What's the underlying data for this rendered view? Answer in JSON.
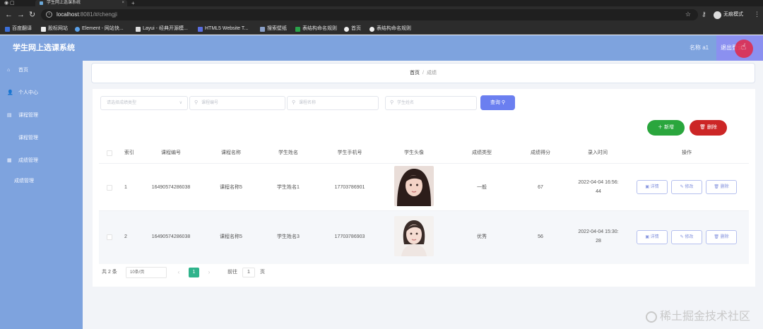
{
  "browser": {
    "tab_title": "学生网上选课系统",
    "url_host": "localhost",
    "url_rest": ":8081/#/chengji",
    "incognito_label": "无痕模式",
    "bookmarks": [
      "百度翻译",
      "股标网站",
      "Element - 网站快...",
      "Layui - 经典开源模...",
      "HTML5 Website T...",
      "搜索壁纸",
      "表结构命名规则",
      "首页",
      "表结构命名规则"
    ]
  },
  "header": {
    "title": "学生网上选课系统",
    "user_label": "名称 a1",
    "logout_label": "退出登录"
  },
  "sidebar": {
    "items": [
      {
        "label": "首页"
      },
      {
        "label": "个人中心"
      },
      {
        "label": "课程管理"
      },
      {
        "label": "课程管理"
      },
      {
        "label": "成绩管理"
      },
      {
        "label": "成绩管理"
      }
    ]
  },
  "breadcrumb": {
    "home": "首页",
    "separator": "/",
    "current": "成绩"
  },
  "filters": {
    "select_placeholder": "请选择成绩类型",
    "course_no_placeholder": "课程编号",
    "course_name_placeholder": "课程名称",
    "student_name_placeholder": "学生姓名",
    "search_label": "查询"
  },
  "actions": {
    "add_label": "新增",
    "delete_label": "删除"
  },
  "table": {
    "headers": [
      "索引",
      "课程编号",
      "课程名称",
      "学生姓名",
      "学生手机号",
      "学生头像",
      "成绩类型",
      "成绩得分",
      "录入时间",
      "操作"
    ],
    "rows": [
      {
        "index": "1",
        "course_no": "16490574286038",
        "course_name": "课程名称5",
        "student_name": "学生姓名1",
        "phone": "17703786901",
        "grade_type": "一般",
        "score": "67",
        "time_line1": "2022-04-04 16:56:",
        "time_line2": "44"
      },
      {
        "index": "2",
        "course_no": "16490574286038",
        "course_name": "课程名称5",
        "student_name": "学生姓名3",
        "phone": "17703786903",
        "grade_type": "优秀",
        "score": "56",
        "time_line1": "2022-04-04 15:30:",
        "time_line2": "28"
      }
    ],
    "op_labels": {
      "detail": "详情",
      "edit": "修改",
      "delete": "删除"
    }
  },
  "pagination": {
    "total": "共 2 条",
    "page_size": "10条/页",
    "current_page": "1",
    "goto_label": "前往",
    "goto_value": "1",
    "page_suffix": "页"
  },
  "watermark": "稀土掘金技术社区",
  "colors": {
    "sidebar": "#7ea3de",
    "search_button": "#6b7ff0",
    "add_button": "#2aa63d",
    "delete_button": "#cc2626",
    "current_page": "#2fb38b"
  }
}
